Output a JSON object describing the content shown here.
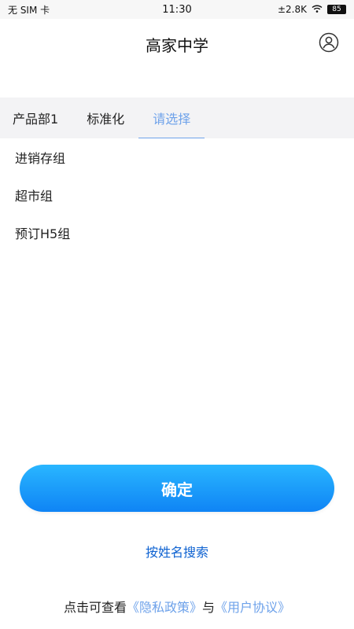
{
  "status_bar": {
    "carrier": "无 SIM 卡",
    "time": "11:30",
    "network_speed": "±2.8K",
    "battery": "85"
  },
  "header": {
    "title": "高家中学"
  },
  "tabs": [
    {
      "label": "产品部1",
      "active": false
    },
    {
      "label": "标准化",
      "active": false
    },
    {
      "label": "请选择",
      "active": true
    }
  ],
  "list": {
    "items": [
      {
        "label": "进销存组"
      },
      {
        "label": "超市组"
      },
      {
        "label": "预订H5组"
      }
    ]
  },
  "actions": {
    "confirm_label": "确定",
    "search_by_name_label": "按姓名搜索"
  },
  "footer": {
    "prefix": "点击可查看",
    "privacy_link": "《隐私政策》",
    "connector": "与",
    "agreement_link": "《用户协议》"
  },
  "colors": {
    "accent": "#6ea2ea",
    "button_top": "#29b6ff",
    "button_bottom": "#0f84f5",
    "link_dark": "#0e62d1",
    "tab_bg": "#f3f3f5"
  }
}
